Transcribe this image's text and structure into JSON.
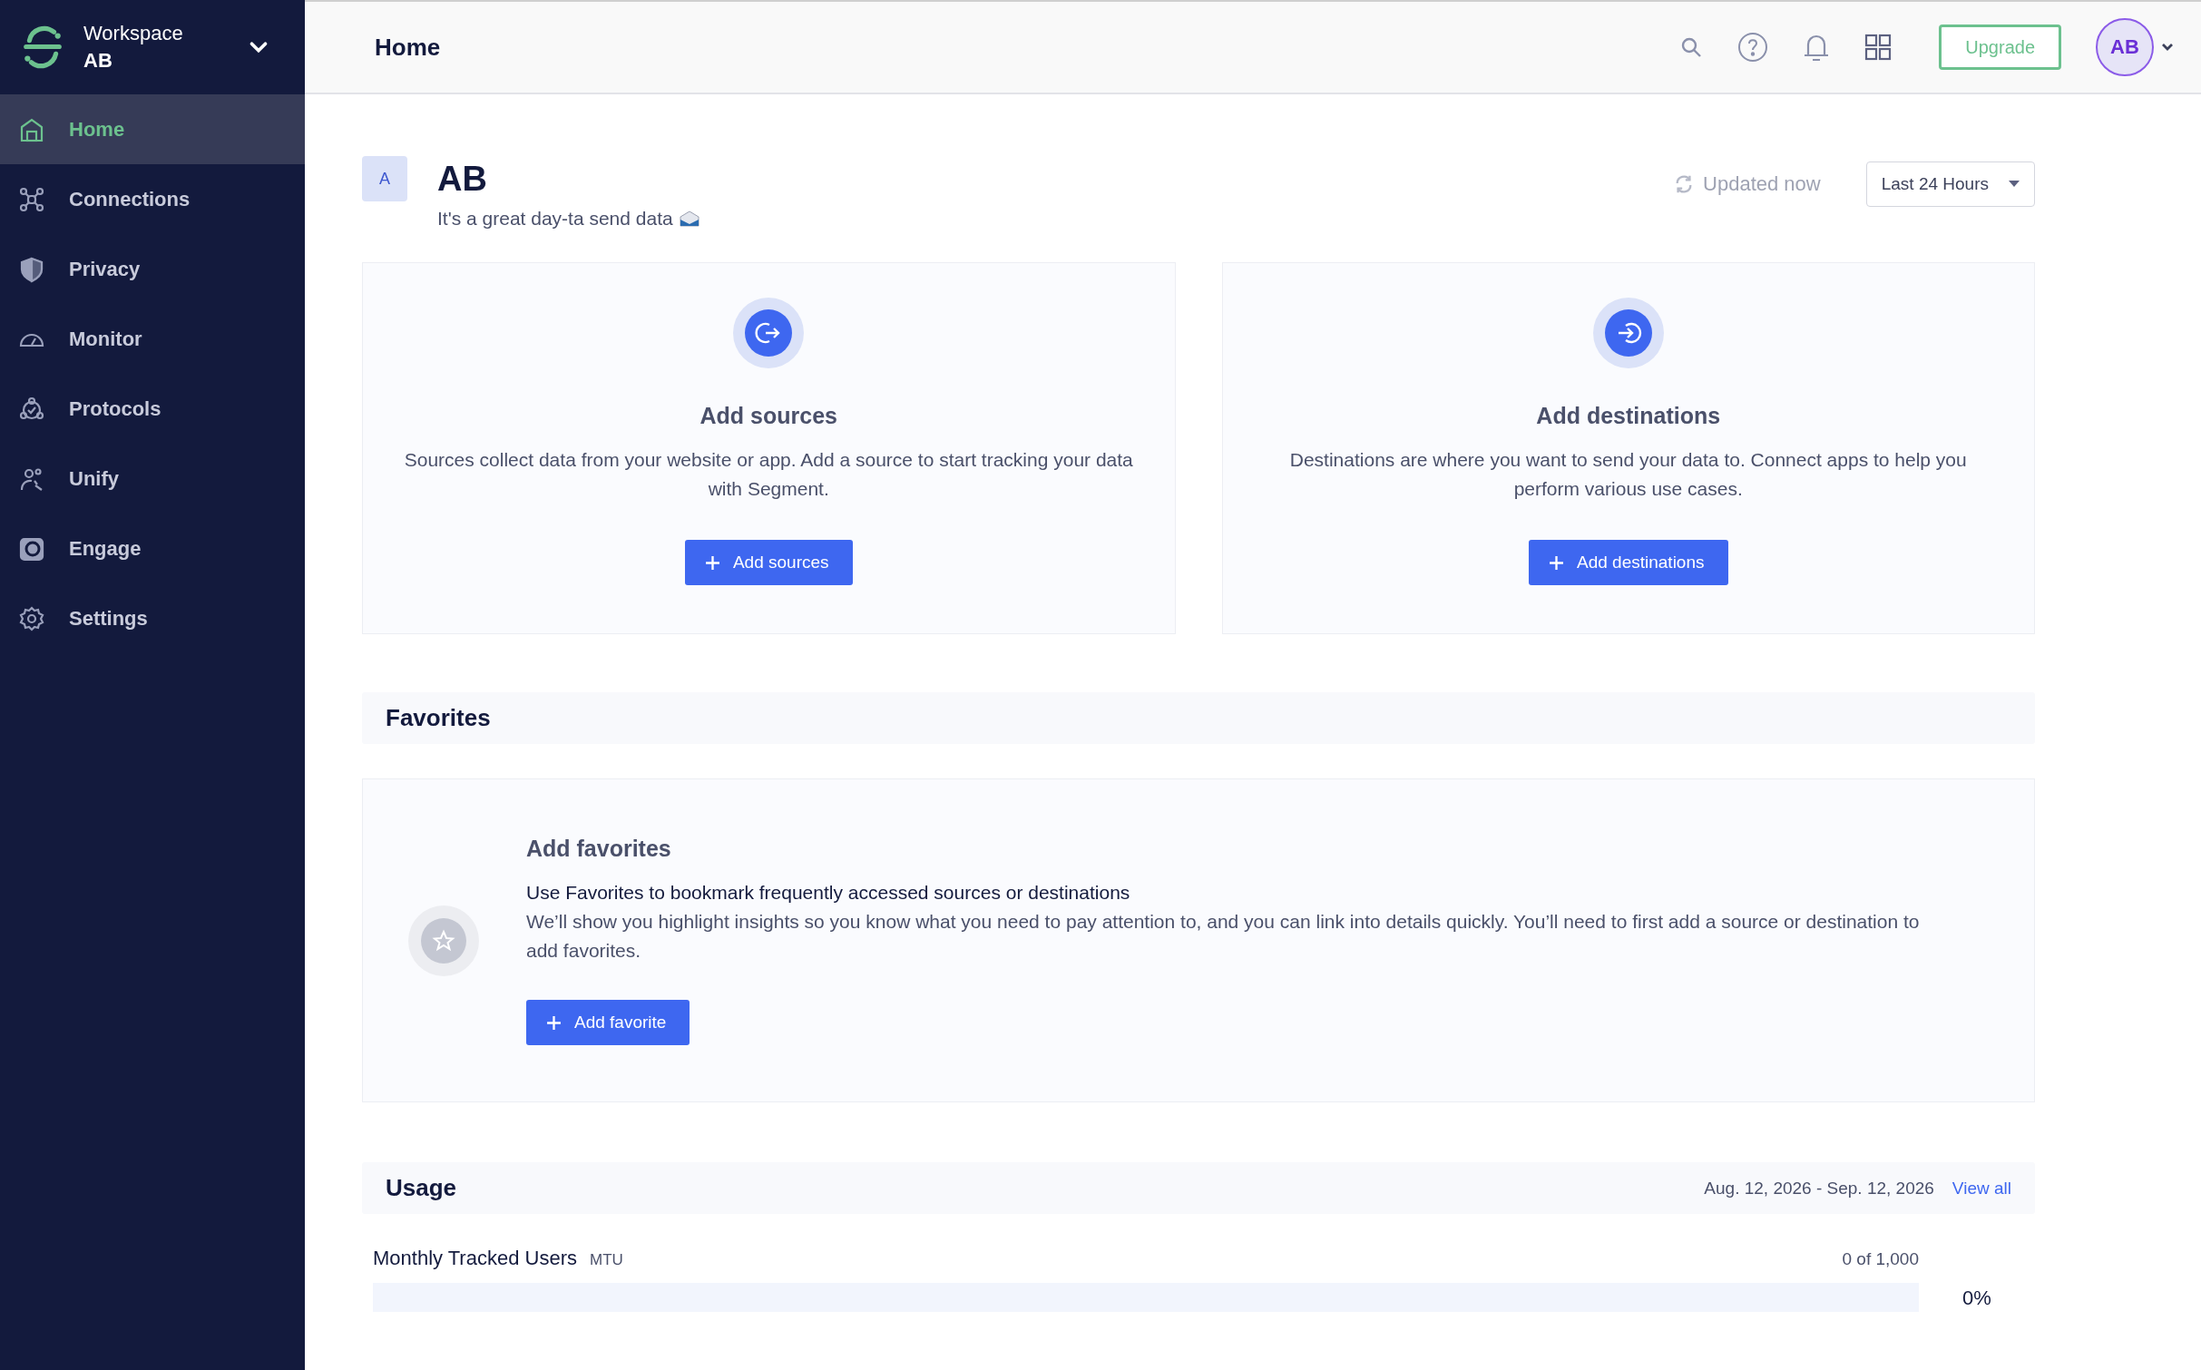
{
  "sidebar": {
    "workspace_label": "Workspace",
    "workspace_name": "AB",
    "items": [
      {
        "label": "Home",
        "selected": true
      },
      {
        "label": "Connections",
        "selected": false
      },
      {
        "label": "Privacy",
        "selected": false
      },
      {
        "label": "Monitor",
        "selected": false
      },
      {
        "label": "Protocols",
        "selected": false
      },
      {
        "label": "Unify",
        "selected": false
      },
      {
        "label": "Engage",
        "selected": false
      },
      {
        "label": "Settings",
        "selected": false
      }
    ]
  },
  "header": {
    "title": "Home",
    "upgrade": "Upgrade",
    "avatar": "AB"
  },
  "workspace": {
    "badge": "A",
    "name": "AB",
    "greeting": "It's a great day-ta send data",
    "updated": "Updated now",
    "range": "Last 24 Hours"
  },
  "cards": [
    {
      "kind": "sources",
      "title": "Add sources",
      "text": "Sources collect data from your website or app. Add a source to start tracking your data with Segment.",
      "button": "Add sources"
    },
    {
      "kind": "destinations",
      "title": "Add destinations",
      "text": "Destinations are where you want to send your data to. Connect apps to help you perform various use cases.",
      "button": "Add destinations"
    }
  ],
  "favorites": {
    "heading": "Favorites",
    "title": "Add favorites",
    "lead": "Use Favorites to bookmark frequently accessed sources or destinations",
    "text": "We’ll show you highlight insights so you know what you need to pay attention to, and you can link into details quickly. You’ll need to first add a source or destination to add favorites.",
    "button": "Add favorite"
  },
  "usage": {
    "heading": "Usage",
    "period": "Aug. 12, 2026 - Sep. 12, 2026",
    "link": "View all",
    "metric": "Monthly Tracked Users",
    "unit": "MTU",
    "count": "0 of 1,000",
    "level": 0,
    "percent": "0%"
  }
}
